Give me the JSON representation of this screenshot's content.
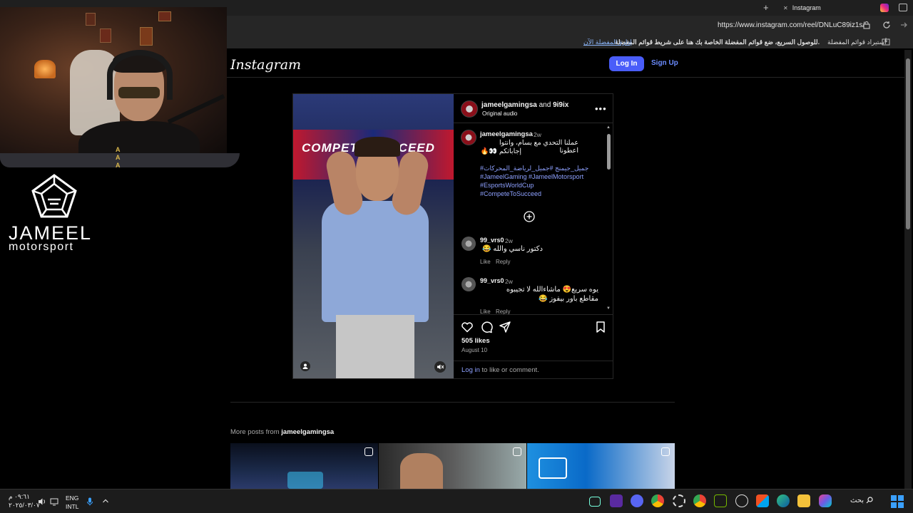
{
  "browser": {
    "tab_title": "Instagram",
    "new_tab": "+",
    "close_tab": "✕",
    "url": "https://www.instagram.com/reel/DNLuC89iz1s/",
    "bookmarks_bar": {
      "import": "استيراد قوائم المفضلة",
      "message": "للوصول السريع، ضع قوائم المفضلة الخاصة بك هنا على شريط قوائم المفضلة.",
      "manage_link": "إدارة المفضلة الآن"
    }
  },
  "overlay": {
    "badge": "A\nA\nA",
    "logo_text": "JAMEEL",
    "logo_sub": "motorsport"
  },
  "instagram": {
    "logo": "Instagram",
    "login": "Log In",
    "signup": "Sign Up",
    "video_banner": "COMPETE SUCCEED",
    "post": {
      "author_main": "jameelgamingsa",
      "author_and": " and ",
      "author_collab": "9i9ix",
      "audio": "Original audio",
      "more": "•••",
      "caption_user": "jameelgamingsa",
      "caption_time": "2w",
      "caption_line1": "عملنا التحدي مع بسام، وانتوا اعطونا",
      "caption_line2": "إجاباتكم 👀🔥",
      "hashtags": [
        "#جميل_جيمنج #جميل_لرياضة_المحركات",
        "#JameelGaming #JameelMotorsport",
        "#EsportsWorldCup",
        "#CompeteToSucceed"
      ],
      "comments": [
        {
          "user": "99_vrs0",
          "time": "2w",
          "text": "دكتور ناسي والله 😂",
          "text2": "",
          "like": "Like",
          "reply": "Reply"
        },
        {
          "user": "99_vrs0",
          "time": "2w",
          "text": "يوه سريع😍 ماشاءالله لا تجيبوه",
          "text2": "مقاطع باور بيفوز 😂",
          "like": "Like",
          "reply": "Reply"
        }
      ],
      "likes": "505 likes",
      "date": "August 10",
      "login_link": "Log in",
      "login_rest": " to like or comment."
    },
    "more_posts_prefix": "More posts from ",
    "more_posts_user": "jameelgamingsa"
  },
  "taskbar": {
    "time": "٠٩:٦١ م",
    "date": "٢٠٢٥/٠٣/٠٧",
    "lang_top": "ENG",
    "lang_bottom": "INTL",
    "search": "بحث"
  },
  "colors": {
    "accent": "#4a5df9",
    "link": "#8ea1ff",
    "background": "#000000"
  }
}
